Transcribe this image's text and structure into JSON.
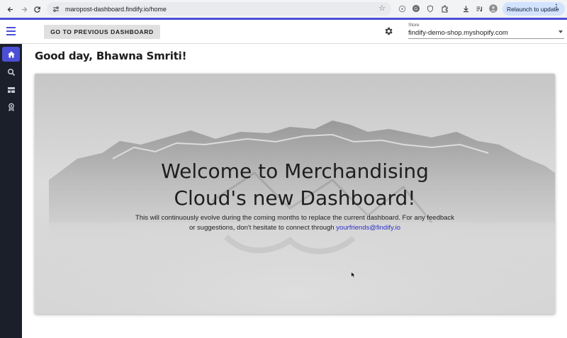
{
  "browser": {
    "url": "maropost-dashboard.findify.io/home",
    "relaunch_label": "Relaunch to update",
    "icons": [
      "back-icon",
      "forward-icon",
      "reload-icon",
      "site-settings-icon",
      "bookmark-star-icon",
      "extension-icons",
      "download-icon",
      "profile-avatar",
      "kebab-menu-icon"
    ]
  },
  "topbar": {
    "prev_dashboard_label": "GO TO PREVIOUS DASHBOARD",
    "store_label": "Store",
    "store_value": "findify-demo-shop.myshopify.com"
  },
  "sidebar": {
    "items": [
      {
        "name": "home",
        "icon": "home-icon",
        "active": true
      },
      {
        "name": "search",
        "icon": "search-icon",
        "active": false
      },
      {
        "name": "layout",
        "icon": "layout-icon",
        "active": false
      },
      {
        "name": "merchandising",
        "icon": "badge-icon",
        "active": false
      }
    ]
  },
  "main": {
    "greeting": "Good day, Bhawna Smriti!",
    "hero": {
      "title_line1": "Welcome to Merchandising",
      "title_line2": "Cloud's new Dashboard!",
      "text": "This will continuously evolve during the coming months to replace the current dashboard. For any feedback or suggestions, don't hesitate to connect through",
      "email_link": "yourfriends@findify.io"
    }
  },
  "colors": {
    "accent": "#4b4fd6",
    "sidebar_bg": "#1b1f2a",
    "link": "#2a2fc8"
  }
}
